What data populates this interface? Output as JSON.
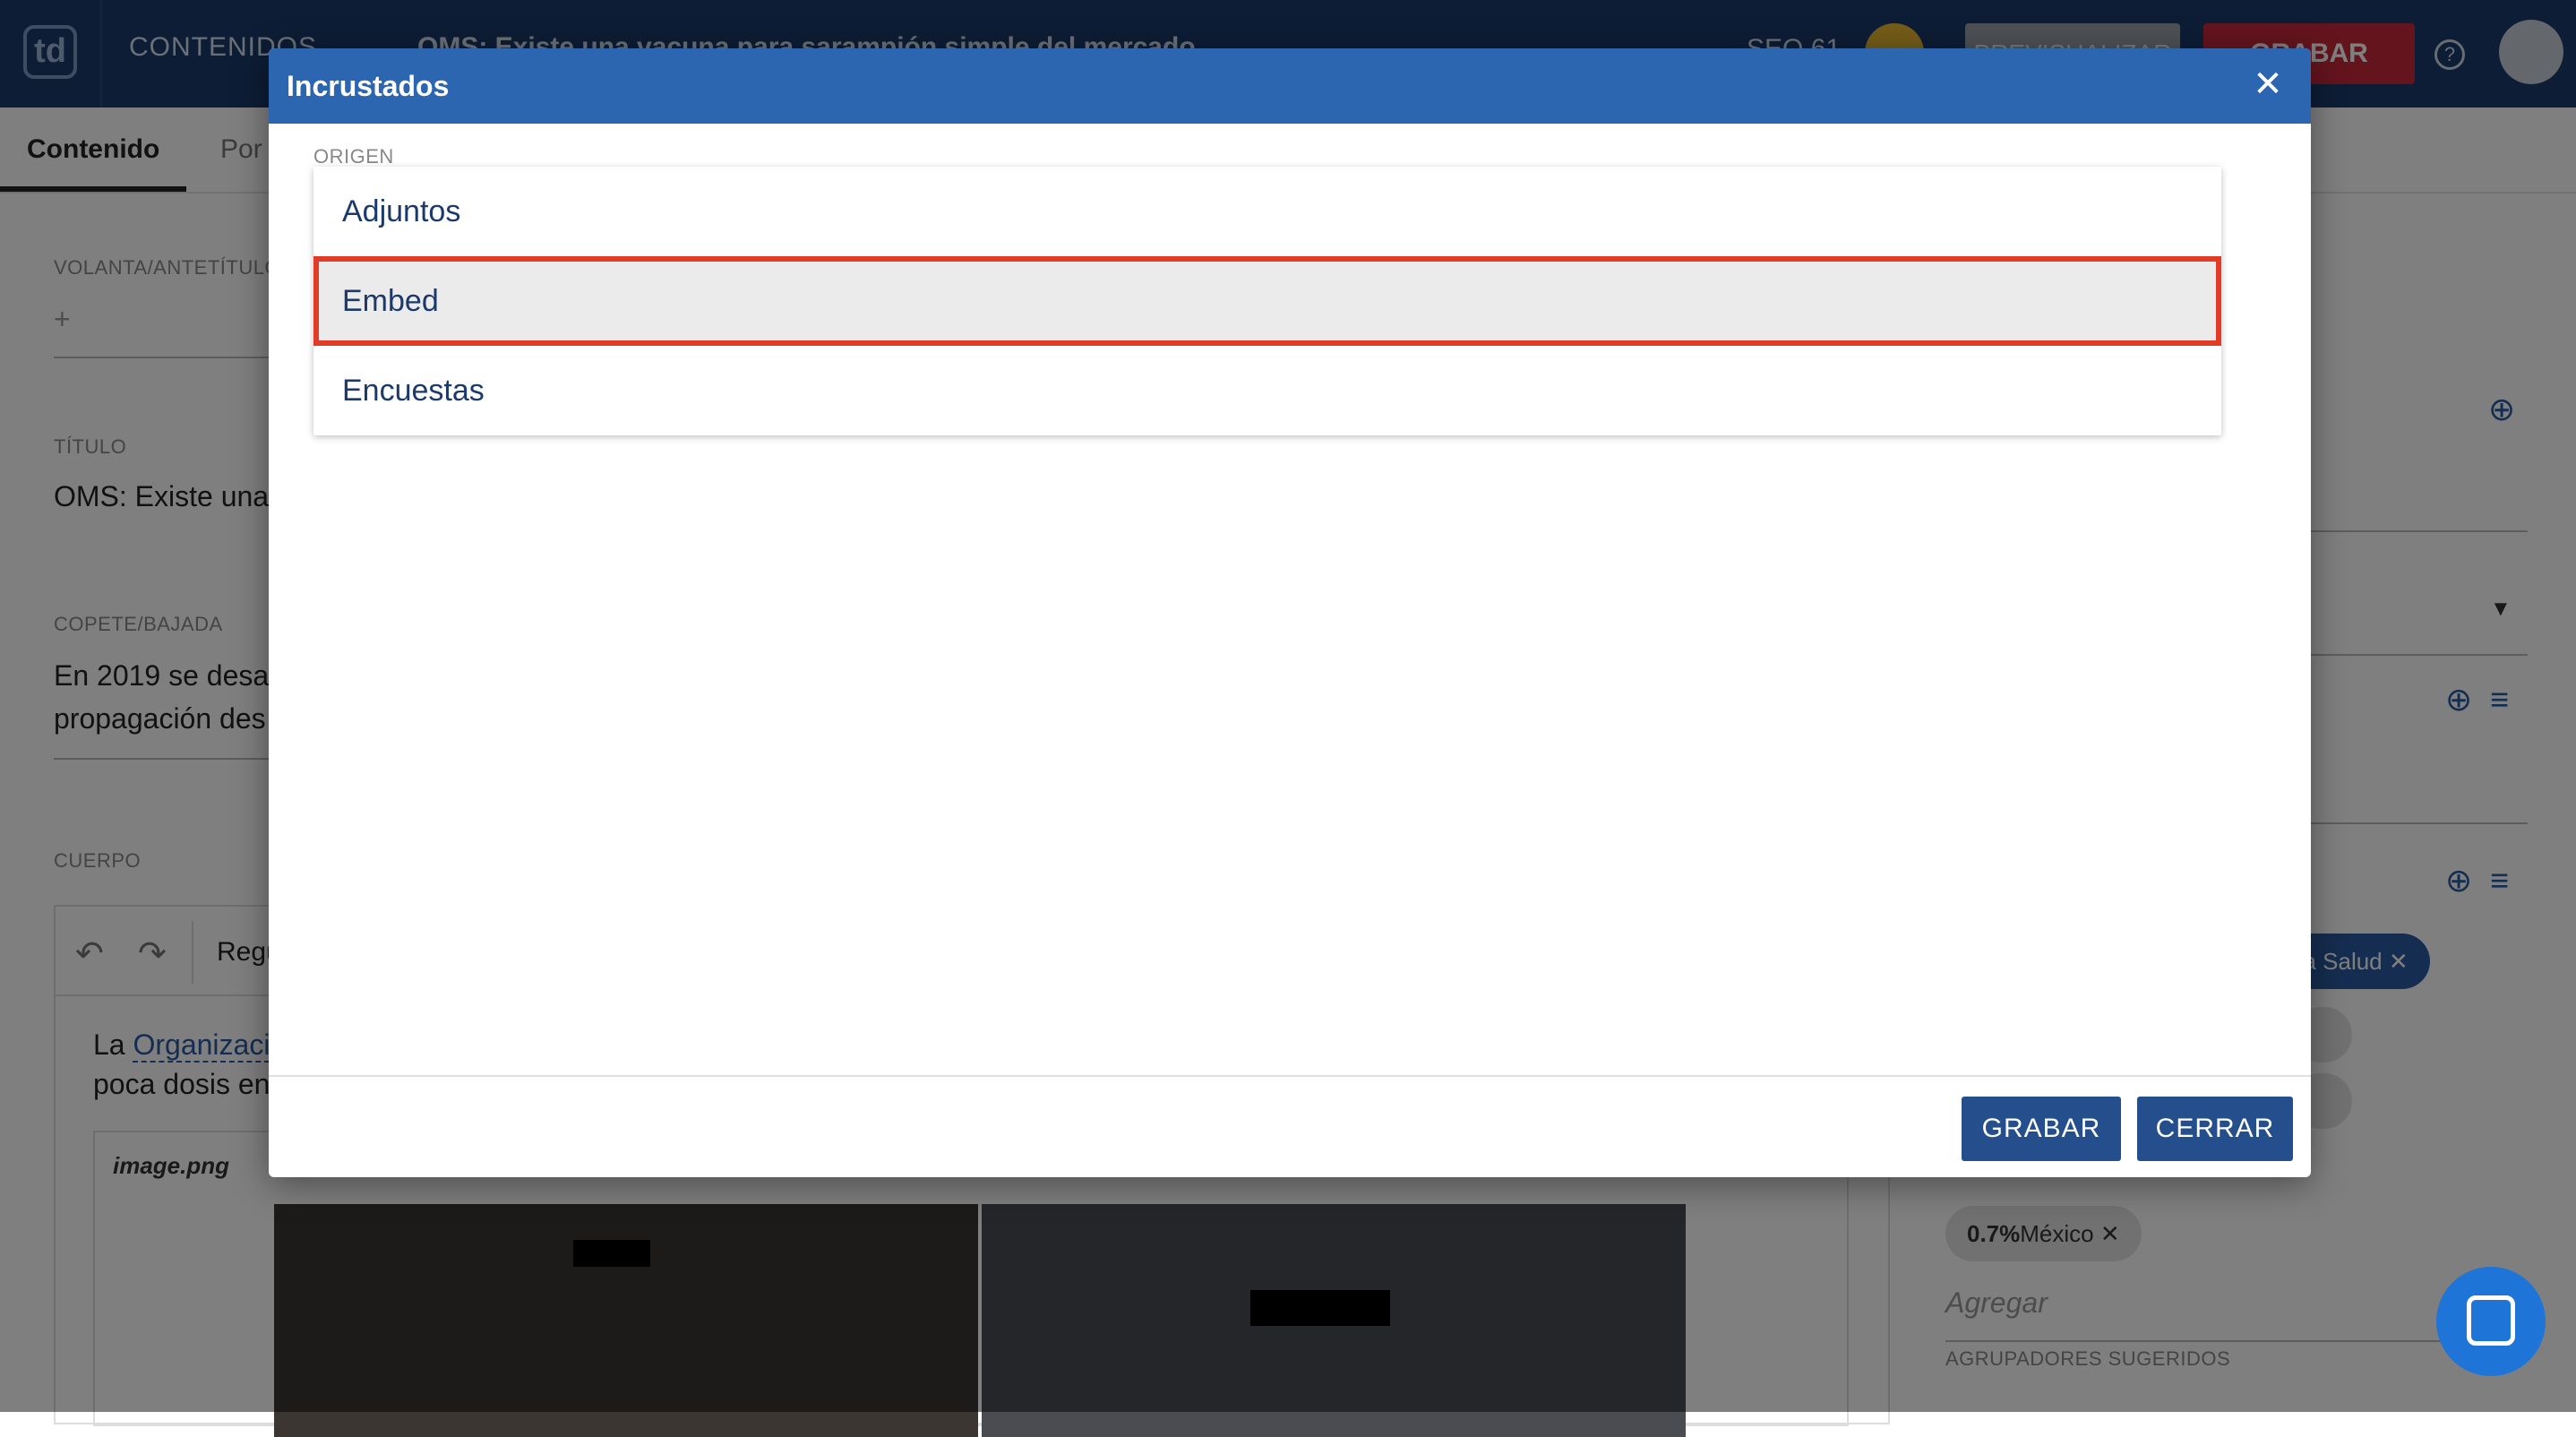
{
  "app": {
    "logo_text": "td",
    "nav_label": "CONTENIDOS",
    "document_title": "OMS: Existe una vacuna para sarampión simple del mercado",
    "seo_label": "SEO 61",
    "primary_button": "GRABAR",
    "secondary_button": "PREVISUALIZAR",
    "help_icon": "help-circle-icon",
    "avatar_icon": "user-avatar-icon"
  },
  "tabs": [
    {
      "label": "Contenido",
      "active": true
    },
    {
      "label": "Por",
      "active": false
    }
  ],
  "form": {
    "volanta_label": "VOLANTA/ANTETÍTULO",
    "volanta_value": "+",
    "titulo_label": "TÍTULO",
    "titulo_value": "OMS: Existe una",
    "copete_label": "COPETE/BAJADA",
    "copete_line1": "En 2019 se desa",
    "copete_line2": "propagación des",
    "cuerpo_label": "CUERPO"
  },
  "editor": {
    "format_label": "Regu",
    "body_prefix": "La ",
    "body_link": "Organizaci",
    "body_line2": "poca dosis en",
    "image_name": "image.png"
  },
  "right_panel": {
    "chip_blue": "e la Salud",
    "chip_mexico_pct": "0.7%",
    "chip_mexico_label": "México",
    "agregar_placeholder": "Agregar",
    "sugeridos_label": "AGRUPADORES SUGERIDOS"
  },
  "modal": {
    "title": "Incrustados",
    "close_icon": "close-icon",
    "origen_label": "ORIGEN",
    "options": [
      "Adjuntos",
      "Embed",
      "Encuestas"
    ],
    "selected_option": "Embed",
    "highlight_color": "#e23b27",
    "grabar_label": "GRABAR",
    "cerrar_label": "CERRAR"
  },
  "colors": {
    "header_bg": "#1b3a6b",
    "modal_header_bg": "#2c66b0",
    "button_bg": "#254f8c"
  }
}
